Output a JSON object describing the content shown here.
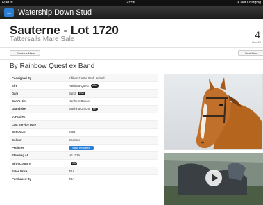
{
  "status": {
    "left": "iPad ᯤ",
    "time": "23:56",
    "right": "⚡ Not Charging"
  },
  "nav": {
    "back_label": "←",
    "title": "Watership Down Stud"
  },
  "lot": {
    "title": "Sauterne - Lot 1720",
    "sale": "Tattersalls Mare Sale",
    "date_big": "4",
    "date_small": "Dec 20"
  },
  "buttons": {
    "prev": "← Previous Mare",
    "next": "→ Next Mare"
  },
  "breeding": "By Rainbow Quest ex Band",
  "details": [
    {
      "key": "Consigned By",
      "value": "Killinan Castle Stud, Ireland"
    },
    {
      "key": "Sire",
      "value": "Rainbow Quest",
      "badge": "USA"
    },
    {
      "key": "Dam",
      "value": "Band",
      "badge": "USA"
    },
    {
      "key": "Dam's Sire",
      "value": "Northern Dancer"
    },
    {
      "key": "Grandsire",
      "value": "Blushing Groom",
      "badge": "FR"
    },
    {
      "key": "In Foal To",
      "value": ""
    },
    {
      "key": "Last Service Date",
      "value": ""
    },
    {
      "key": "Birth Year",
      "value": "1999"
    },
    {
      "key": "Colour",
      "value": "Chestnut"
    },
    {
      "key": "Pedigree",
      "value": "",
      "button": "View Pedigree"
    },
    {
      "key": "Standing At",
      "value": "HF 1129"
    },
    {
      "key": "Birth Country",
      "value": "",
      "badge": "GB"
    },
    {
      "key": "Sales Price",
      "value": "TBA"
    },
    {
      "key": "Purchased By",
      "value": "TBA"
    }
  ],
  "colors": {
    "accent": "#2a7fd4",
    "navbar": "#1b1b1b",
    "badge": "#222222"
  },
  "icons": {
    "play": "play-icon",
    "back": "back-arrow-icon"
  }
}
